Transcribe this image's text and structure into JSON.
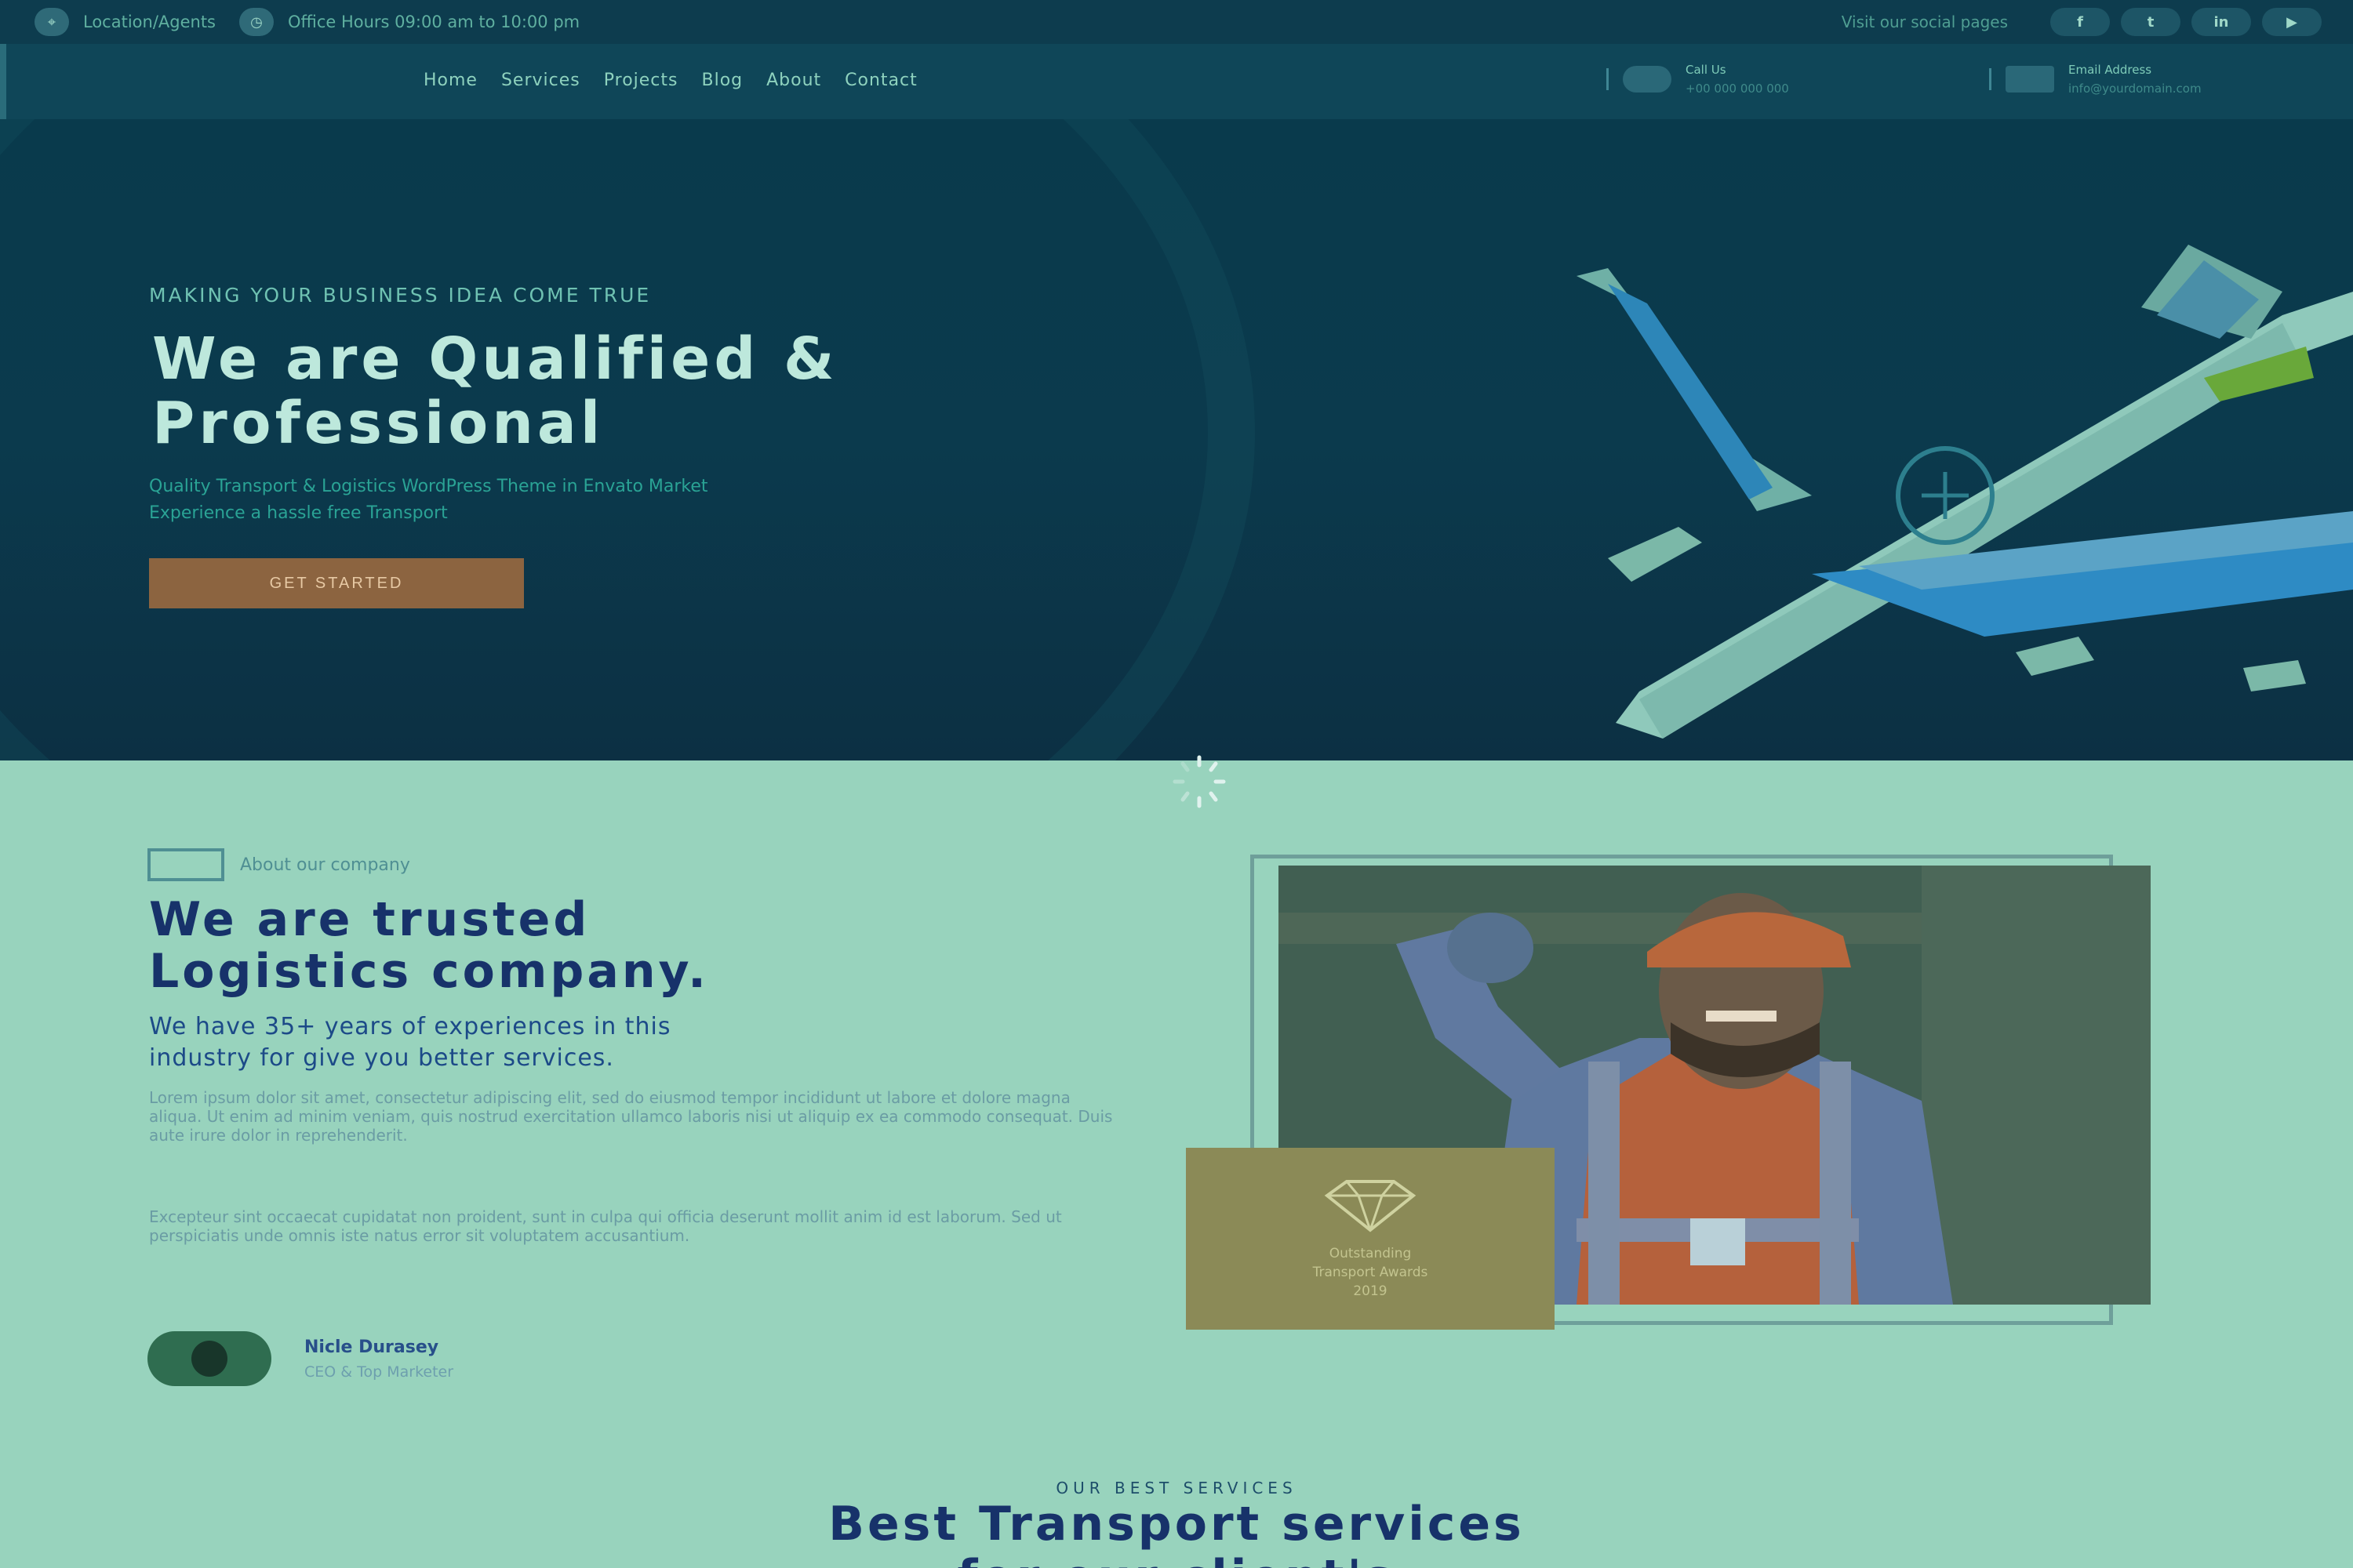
{
  "topbar": {
    "location": "Location/Agents",
    "office_hours": "Office Hours 09:00 am to 10:00 pm",
    "social_label": "Visit our social pages",
    "social": [
      {
        "icon": "facebook-icon",
        "glyph": "f"
      },
      {
        "icon": "twitter-icon",
        "glyph": "t"
      },
      {
        "icon": "linkedin-icon",
        "glyph": "in"
      },
      {
        "icon": "youtube-icon",
        "glyph": "▶"
      }
    ]
  },
  "nav": {
    "items": [
      "Home",
      "Services",
      "Projects",
      "Blog",
      "About",
      "Contact"
    ],
    "call_label": "Call Us",
    "call_value": "+00 000 000 000",
    "email_label": "Email Address",
    "email_value": "info@yourdomain.com"
  },
  "hero": {
    "kicker": "MAKING YOUR BUSINESS IDEA COME TRUE",
    "title_line1": "We are Qualified &",
    "title_line2": "Professional",
    "sub_line1": "Quality Transport & Logistics WordPress Theme in Envato Market",
    "sub_line2": "Experience a hassle free Transport",
    "cta": "GET STARTED"
  },
  "about": {
    "tag": "About our company",
    "title_line1": "We are trusted",
    "title_line2": "Logistics company.",
    "lead_line1": "We have 35+ years of experiences in this",
    "lead_line2": "industry for give you better services.",
    "para1": "Lorem ipsum dolor sit amet, consectetur adipiscing elit, sed do eiusmod tempor incididunt ut labore et dolore magna aliqua. Ut enim ad minim veniam, quis nostrud exercitation ullamco laboris nisi ut aliquip ex ea commodo consequat. Duis aute irure dolor in reprehenderit.",
    "para2": "Excepteur sint occaecat cupidatat non proident, sunt in culpa qui officia deserunt mollit anim id est laborum. Sed ut perspiciatis unde omnis iste natus error sit voluptatem accusantium.",
    "author_name": "Nicle Durasey",
    "author_role": "CEO & Top Marketer",
    "badge_title": "Outstanding",
    "badge_sub": "Transport Awards",
    "badge_year": "2019"
  },
  "services": {
    "kicker": "OUR BEST SERVICES",
    "title": "Best Transport services",
    "title_line2": "for our client's"
  },
  "colors": {
    "hero_bg": "#0b3a4d",
    "accent_button": "#8c6440",
    "section_bg": "#98d3bd",
    "heading_dark": "#17326a"
  }
}
